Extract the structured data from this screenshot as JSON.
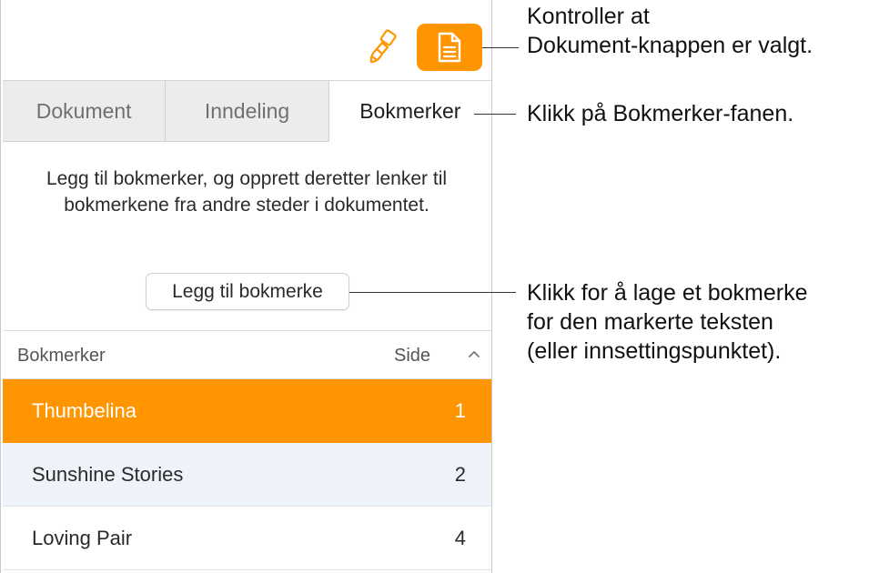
{
  "toolbar": {
    "format_icon": "paintbrush-icon",
    "document_icon": "document-icon",
    "accent_color": "#ff9500"
  },
  "tabs": [
    {
      "label": "Dokument",
      "active": false
    },
    {
      "label": "Inndeling",
      "active": false
    },
    {
      "label": "Bokmerker",
      "active": true
    }
  ],
  "bookmarks_pane": {
    "description": "Legg til bokmerker, og opprett deretter lenker til bokmerkene fra andre steder i dokumentet.",
    "add_button": "Legg til bokmerke",
    "columns": {
      "name": "Bokmerker",
      "page": "Side"
    },
    "sort_icon": "chevron-up-icon",
    "rows": [
      {
        "name": "Thumbelina",
        "page": "1",
        "selected": true
      },
      {
        "name": "Sunshine Stories",
        "page": "2",
        "selected": false
      },
      {
        "name": "Loving Pair",
        "page": "4",
        "selected": false
      }
    ]
  },
  "callouts": {
    "document_button_line1": "Kontroller at",
    "document_button_line2": "Dokument-knappen er valgt.",
    "bookmarks_tab": "Klikk på Bokmerker-fanen.",
    "add_bookmark_line1": "Klikk for å lage et bokmerke",
    "add_bookmark_line2": "for den markerte teksten",
    "add_bookmark_line3": "(eller innsettingspunktet)."
  }
}
